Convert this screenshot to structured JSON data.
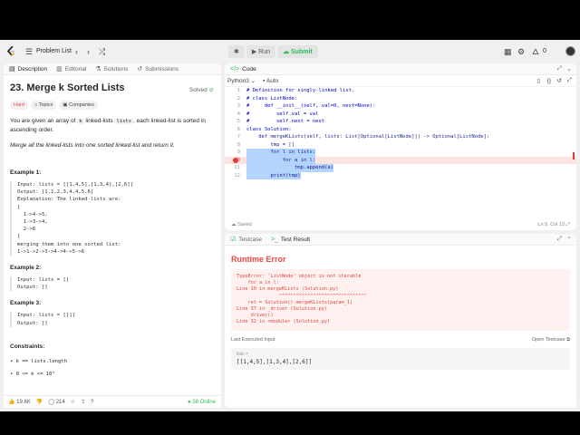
{
  "nav": {
    "problem_list": "Problem List",
    "run": "Run",
    "submit": "Submit",
    "coins": "0",
    "accent": "#ffa116"
  },
  "left_tabs": [
    "Description",
    "Editorial",
    "Solutions",
    "Submissions"
  ],
  "problem": {
    "title": "23. Merge k Sorted Lists",
    "status": "Solved",
    "difficulty": "Hard",
    "tags": [
      "Topics",
      "Companies"
    ],
    "intro_a": "You are given an array of ",
    "intro_k": "k",
    "intro_b": " linked-lists ",
    "intro_lists": "lists",
    "intro_c": ", each linked-list is sorted in ascending order.",
    "task": "Merge all the linked-lists into one sorted linked-list and return it.",
    "examples": [
      {
        "heading": "Example 1:",
        "body": "Input: lists = [[1,4,5],[1,3,4],[2,6]]\nOutput: [1,1,2,3,4,4,5,6]\nExplanation: The linked-lists are:\n[\n  1->4->5,\n  1->3->4,\n  2->6\n]\nmerging them into one sorted list:\n1->1->2->3->4->4->5->6"
      },
      {
        "heading": "Example 2:",
        "body": "Input: lists = []\nOutput: []"
      },
      {
        "heading": "Example 3:",
        "body": "Input: lists = [[]]\nOutput: []"
      }
    ],
    "constraints_heading": "Constraints:",
    "constraints": [
      "k == lists.length",
      "0 <= k <= 10⁴"
    ]
  },
  "footer": {
    "likes": "19.6K",
    "comments": "214",
    "online": "36 Online"
  },
  "code_panel": {
    "tab": "Code",
    "language": "Python3",
    "autocomplete": "Auto",
    "lines": [
      "# Definition for singly-linked list.",
      "# class ListNode:",
      "#     def __init__(self, val=0, next=None):",
      "#         self.val = val",
      "#         self.next = next",
      "class Solution:",
      "    def mergeKLists(self, lists: List[Optional[ListNode]]) -> Optional[ListNode]:",
      "        tmp = []",
      "        for l in lists:",
      "            for a in l:",
      "                tmp.append(a)",
      "        print(tmp)"
    ],
    "saved": "Saved",
    "cursor": "Ln 9, Col 13"
  },
  "test_panel": {
    "tabs": [
      "Testcase",
      "Test Result"
    ],
    "result_title": "Runtime Error",
    "error_text": "TypeError: 'ListNode' object is not iterable\n    for a in l:\nLine 10 in mergeKLists (Solution.py)\n               ^^^^^^^^^^^^^^^^^^^^^^^^^^^^^^^\n    ret = Solution().mergeKLists(param_1)\nLine 37 in _driver (Solution.py)\n    _driver()\nLine 32 in <module> (Solution.py)",
    "last_input_label": "Last Executed Input",
    "open_testcase": "Open Testcase",
    "input_label": "lists =",
    "input_value": "[[1,4,5],[1,3,4],[2,6]]"
  }
}
